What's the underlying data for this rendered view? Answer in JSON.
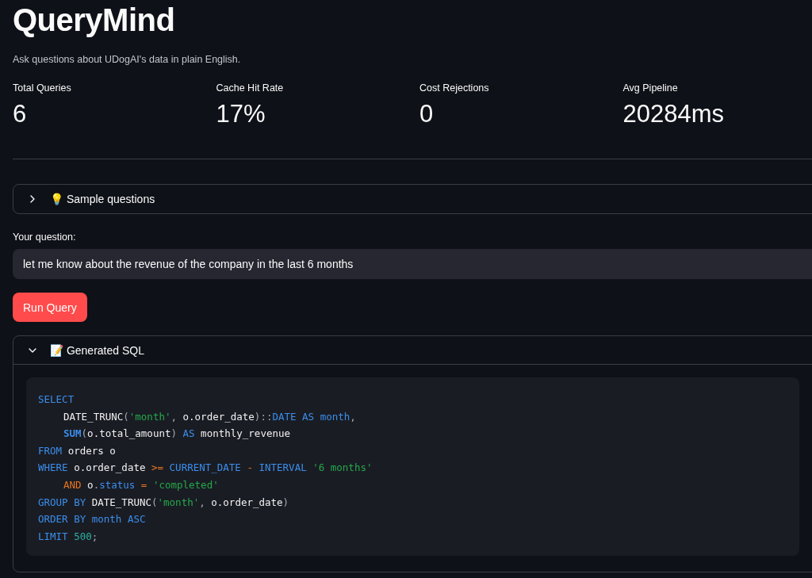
{
  "title": "QueryMind",
  "subtitle": "Ask questions about UDogAI's data in plain English.",
  "metrics": [
    {
      "label": "Total Queries",
      "value": "6"
    },
    {
      "label": "Cache Hit Rate",
      "value": "17%"
    },
    {
      "label": "Cost Rejections",
      "value": "0"
    },
    {
      "label": "Avg Pipeline",
      "value": "20284ms"
    }
  ],
  "sample_questions": {
    "label": "💡 Sample questions",
    "expanded": false
  },
  "question": {
    "label": "Your question:",
    "value": "let me know about the revenue of the company in the last 6 months"
  },
  "run_button": "Run Query",
  "generated_sql": {
    "label": "📝 Generated SQL",
    "expanded": true,
    "lines": [
      {
        "indented": false,
        "tokens": [
          {
            "kind": "kw",
            "text": "SELECT"
          }
        ]
      },
      {
        "indented": true,
        "tokens": [
          {
            "kind": "plain",
            "text": "DATE_TRUNC"
          },
          {
            "kind": "punct",
            "text": "("
          },
          {
            "kind": "str",
            "text": "'month'"
          },
          {
            "kind": "punct",
            "text": ", "
          },
          {
            "kind": "plain",
            "text": "o.order_date"
          },
          {
            "kind": "punct",
            "text": ")::"
          },
          {
            "kind": "kw",
            "text": "DATE AS month"
          },
          {
            "kind": "punct",
            "text": ","
          }
        ]
      },
      {
        "indented": true,
        "tokens": [
          {
            "kind": "fn",
            "text": "SUM"
          },
          {
            "kind": "punct",
            "text": "("
          },
          {
            "kind": "plain",
            "text": "o.total_amount"
          },
          {
            "kind": "punct",
            "text": ") "
          },
          {
            "kind": "kw",
            "text": "AS"
          },
          {
            "kind": "plain",
            "text": " monthly_revenue"
          }
        ]
      },
      {
        "indented": false,
        "tokens": [
          {
            "kind": "kw",
            "text": "FROM"
          },
          {
            "kind": "plain",
            "text": " orders o"
          }
        ]
      },
      {
        "indented": false,
        "tokens": [
          {
            "kind": "kw",
            "text": "WHERE"
          },
          {
            "kind": "plain",
            "text": " o.order_date "
          },
          {
            "kind": "op",
            "text": ">="
          },
          {
            "kind": "kw",
            "text": " CURRENT_DATE "
          },
          {
            "kind": "op",
            "text": "-"
          },
          {
            "kind": "kw",
            "text": " INTERVAL "
          },
          {
            "kind": "str",
            "text": "'6 months'"
          }
        ]
      },
      {
        "indented": true,
        "tokens": [
          {
            "kind": "op",
            "text": "AND"
          },
          {
            "kind": "plain",
            "text": " o"
          },
          {
            "kind": "punct",
            "text": "."
          },
          {
            "kind": "kw",
            "text": "status"
          },
          {
            "kind": "op",
            "text": " = "
          },
          {
            "kind": "str",
            "text": "'completed'"
          }
        ]
      },
      {
        "indented": false,
        "tokens": [
          {
            "kind": "kw",
            "text": "GROUP BY"
          },
          {
            "kind": "plain",
            "text": " DATE_TRUNC"
          },
          {
            "kind": "punct",
            "text": "("
          },
          {
            "kind": "str",
            "text": "'month'"
          },
          {
            "kind": "punct",
            "text": ", "
          },
          {
            "kind": "plain",
            "text": "o.order_date"
          },
          {
            "kind": "punct",
            "text": ")"
          }
        ]
      },
      {
        "indented": false,
        "tokens": [
          {
            "kind": "kw",
            "text": "ORDER BY month ASC"
          }
        ]
      },
      {
        "indented": false,
        "tokens": [
          {
            "kind": "kw",
            "text": "LIMIT"
          },
          {
            "kind": "num",
            "text": " 500"
          },
          {
            "kind": "punct",
            "text": ";"
          }
        ]
      }
    ]
  }
}
